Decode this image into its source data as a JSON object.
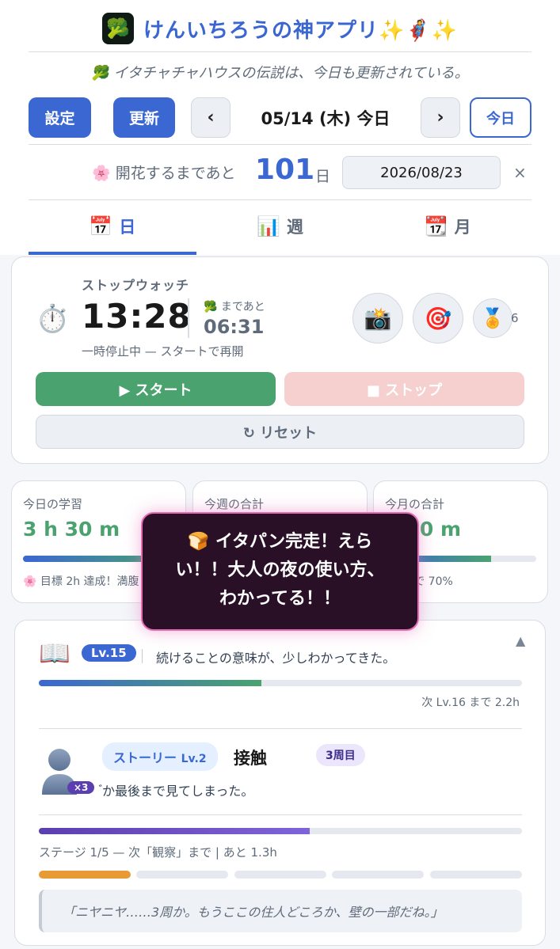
{
  "header": {
    "title": "けんいちろうの神アプリ✨🦸✨",
    "icon": "broccoli-app-icon",
    "subtitle": "🥦 イタチャチャハウスの伝説は、今日も更新されている。"
  },
  "nav": {
    "settings_label": "設定",
    "refresh_label": "更新",
    "prev_label": "‹",
    "next_label": "›",
    "date_text": "05/14 (木) 今日",
    "today_label": "今日"
  },
  "countdown": {
    "label": "🌸 開花するまであと",
    "days": "101",
    "unit": "日",
    "target_date": "2026/08/23",
    "clear_label": "×"
  },
  "tabs": [
    {
      "icon": "📅",
      "label": "日"
    },
    {
      "icon": "📊",
      "label": "週"
    },
    {
      "icon": "📆",
      "label": "月"
    }
  ],
  "stopwatch": {
    "title": "ストップウォッチ",
    "icon": "⏱️",
    "time": "13:28",
    "until_label": "🥦 まであと",
    "until_time": "06:31",
    "status": "一時停止中 — スタートで再開",
    "camera_icon": "📸",
    "target_icon": "🎯",
    "medal_icon": "🏅",
    "medal_count": "6",
    "start_label": "▶ スタート",
    "stop_label": "■ ストップ",
    "reset_label": "↻ リセット"
  },
  "stats": [
    {
      "label": "今日の学習",
      "value": "3 h 30 m",
      "foot": "🌸 目標 2h 達成！満腹",
      "progress": 1.0
    },
    {
      "label": "今週の合計",
      "value": "",
      "foot": "",
      "progress": 0.0
    },
    {
      "label": "今月の合計",
      "value": "h 50 m",
      "foot": "0h まで 70%",
      "progress": 0.7
    }
  ],
  "toast": {
    "text": "🍞 イタパン完走！えらい！！大人の夜の使い方、わかってる！！"
  },
  "level": {
    "icon": "📖",
    "badge": "Lv.15",
    "message": "続けることの意味が、少しわかってきた。",
    "toggle": "▲",
    "progress": 0.46,
    "next_text": "次 Lv.16 まで 2.2h"
  },
  "story": {
    "multiplier": "×3",
    "chip_label": "ストーリー",
    "chip_level": "Lv.2",
    "name": "接触",
    "lap": "3周目",
    "line": "゙か最後まで見てしまった。",
    "progress": 0.56,
    "stage_info": "ステージ 1/5 — 次「観察」まで | あと 1.3h",
    "stages_done": 1,
    "stages_total": 5,
    "quote": "「ニヤニヤ……3周か。もうここの住人どころか、壁の一部だね。」"
  },
  "colors": {
    "primary": "#3b67d3",
    "green": "#4aa36f",
    "toast_bg": "#2a1027",
    "toast_border": "#e56bb4",
    "stage_done": "#e89a35"
  }
}
